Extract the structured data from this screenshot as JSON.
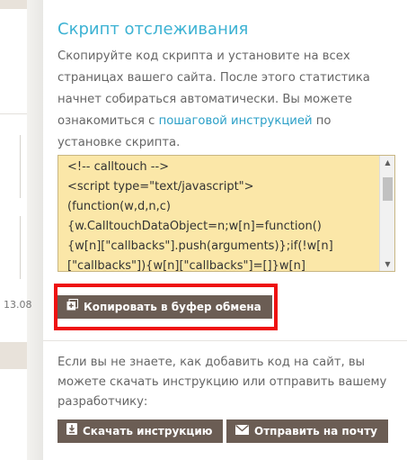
{
  "background": {
    "date_label": "13.08"
  },
  "panel": {
    "title": "Скрипт отслеживания",
    "desc_before_link": "Скопируйте код скрипта и установите на всех страницах вашего сайта. После этого статистика начнет собираться автоматически. Вы можете ознакомиться с ",
    "desc_link": "пошаговой инструкцией",
    "desc_after_link": " по установке скрипта.",
    "code_text": "<!-- calltouch -->\n<script type=\"text/javascript\">\n(function(w,d,n,c)\n{w.CalltouchDataObject=n;w[n]=function()\n{w[n][\"callbacks\"].push(arguments)};if(!w[n]\n[\"callbacks\"]){w[n][\"callbacks\"]=[]}w[n]\n[\"loaded\"]=false;if(typeof c!==\"object\"){",
    "copy_button": "Копировать в буфер обмена",
    "help_text": "Если вы не знаете, как добавить код на сайт, вы можете скачать инструкцию или отправить вашему разработчику:",
    "download_button": "Скачать инструкцию",
    "mail_button": "Отправить на почту"
  },
  "colors": {
    "title": "#3cb2d3",
    "link": "#2a9fc7",
    "button_bg": "#6b5d54",
    "code_bg": "#fbe7a8",
    "highlight": "#ee1111"
  }
}
